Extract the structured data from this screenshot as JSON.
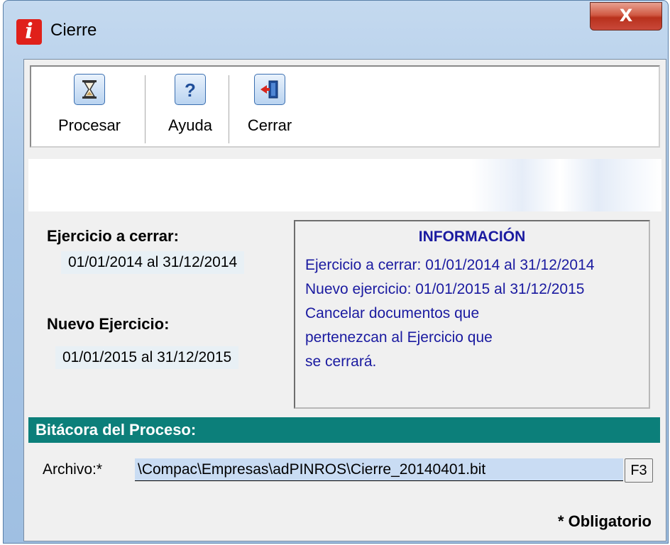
{
  "window": {
    "title": "Cierre",
    "close_label": "X"
  },
  "toolbar": {
    "buttons": [
      {
        "label": "Procesar",
        "icon": "hourglass-icon"
      },
      {
        "label": "Ayuda",
        "icon": "help-icon"
      },
      {
        "label": "Cerrar",
        "icon": "exit-door-icon"
      }
    ]
  },
  "form": {
    "ejercicio_label": "Ejercicio a cerrar:",
    "ejercicio_value": "01/01/2014 al 31/12/2014",
    "nuevo_label": "Nuevo Ejercicio:",
    "nuevo_value": "01/01/2015 al 31/12/2015"
  },
  "info": {
    "title": "INFORMACIÓN",
    "lines": [
      "Ejercicio a cerrar: 01/01/2014 al 31/12/2014",
      "Nuevo ejercicio: 01/01/2015 al 31/12/2015",
      "Cancelar documentos que",
      "pertenezcan al Ejercicio que",
      "se cerrará."
    ]
  },
  "log": {
    "header": "Bitácora del Proceso:",
    "file_label": "Archivo:*",
    "file_value": "\\Compac\\Empresas\\adPINROS\\Cierre_20140401.bit",
    "f3_label": "F3"
  },
  "footer": {
    "required_note": "* Obligatorio"
  },
  "colors": {
    "log_bar": "#0c7f7a",
    "info_text": "#1a1aa0",
    "app_icon": "#e0201a"
  }
}
